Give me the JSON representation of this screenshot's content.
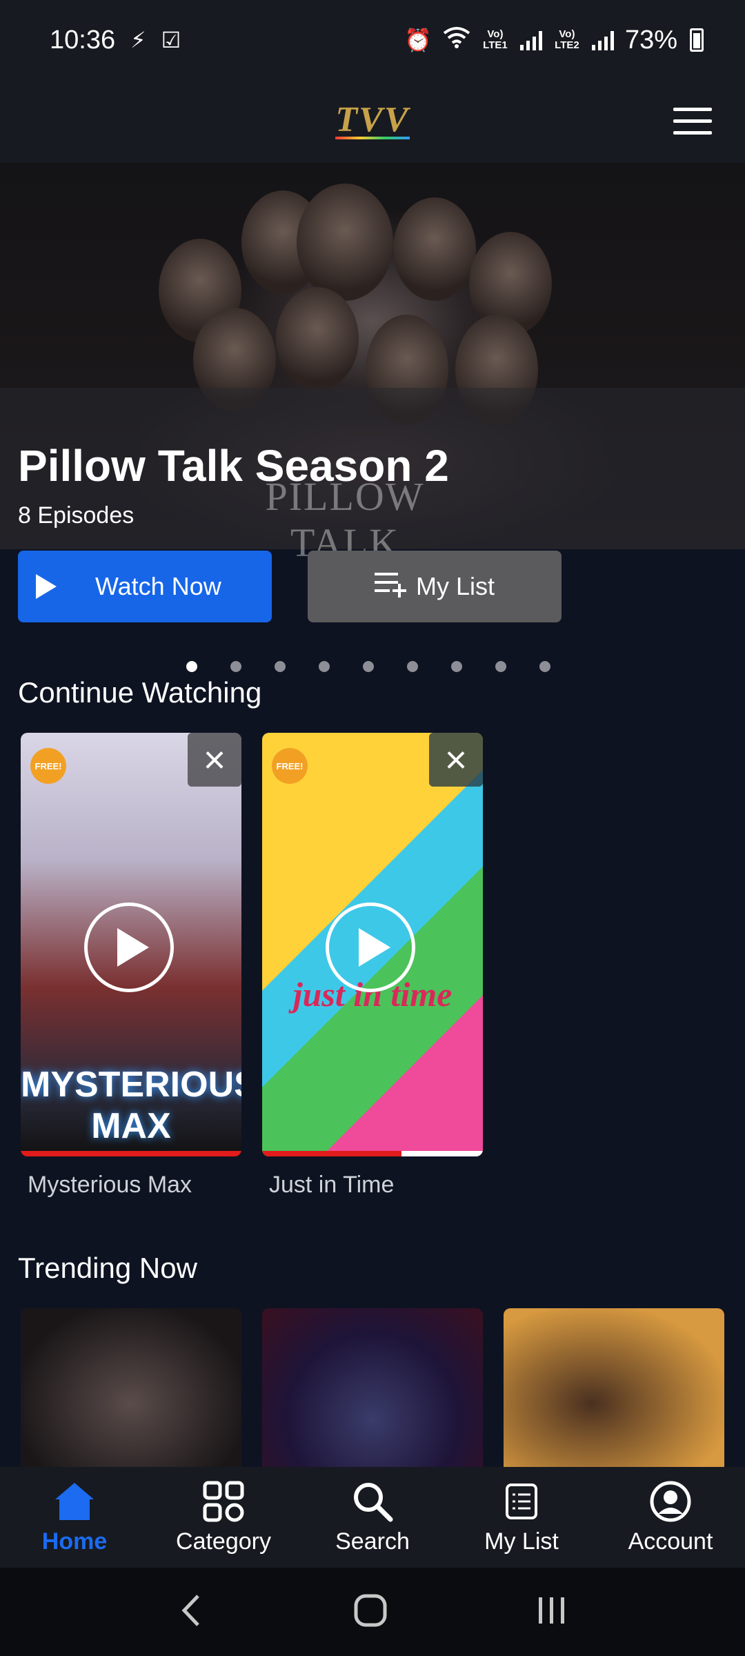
{
  "status_bar": {
    "time": "10:36",
    "battery": "73%",
    "sim1": "Vo) LTE1",
    "sim2": "Vo) LTE2",
    "icons": [
      "bolt-icon",
      "checkbox-icon",
      "alarm-icon",
      "wifi-icon",
      "signal-icon",
      "battery-icon"
    ]
  },
  "header": {
    "logo": "TVV",
    "menu_icon": "hamburger-menu-icon"
  },
  "hero": {
    "title": "Pillow Talk Season 2",
    "subtitle": "8 Episodes",
    "poster_watermark": "PILLOW TALK",
    "watch_label": "Watch Now",
    "mylist_label": "My List",
    "slide_count": 9,
    "active_slide": 1
  },
  "continue_watching": {
    "title": "Continue Watching",
    "items": [
      {
        "title": "Mysterious Max",
        "poster_title": "MYSTERIOUS MAX",
        "badge": "FREE!",
        "progress": 1.0
      },
      {
        "title": "Just in Time",
        "poster_title": "just in time",
        "badge": "FREE!",
        "progress": 0.63
      }
    ]
  },
  "trending": {
    "title": "Trending Now"
  },
  "bottom_nav": {
    "items": [
      {
        "label": "Home",
        "icon": "home-icon",
        "active": true
      },
      {
        "label": "Category",
        "icon": "grid-icon",
        "active": false
      },
      {
        "label": "Search",
        "icon": "search-icon",
        "active": false
      },
      {
        "label": "My List",
        "icon": "list-icon",
        "active": false
      },
      {
        "label": "Account",
        "icon": "account-icon",
        "active": false
      }
    ]
  },
  "colors": {
    "accent": "#1766e8",
    "background": "#0e1322",
    "progress": "#e21b1b"
  }
}
